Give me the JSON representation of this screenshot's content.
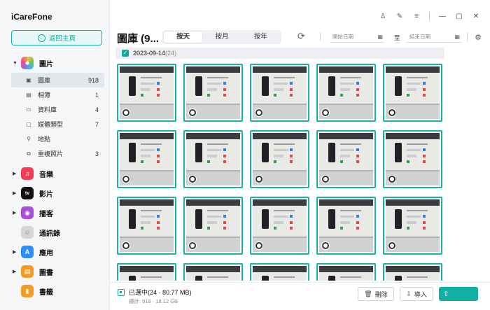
{
  "app": {
    "title": "iCareFone"
  },
  "sidebar": {
    "home_label": "返回主頁",
    "categories": [
      {
        "label": "圖片",
        "color": "#f5a33b",
        "glyph": "✿"
      },
      {
        "label": "音樂",
        "color": "#f23b55",
        "glyph": "♫"
      },
      {
        "label": "影片",
        "color": "#111111",
        "glyph": "tv"
      },
      {
        "label": "播客",
        "color": "#a84fd8",
        "glyph": "◉"
      },
      {
        "label": "通訊錄",
        "color": "#c8c8c8",
        "glyph": "☺"
      },
      {
        "label": "應用",
        "color": "#2f8ef5",
        "glyph": "A"
      },
      {
        "label": "圖書",
        "color": "#f59a22",
        "glyph": "▤"
      },
      {
        "label": "書籤",
        "color": "#f59a22",
        "glyph": "▮"
      }
    ],
    "photo_items": [
      {
        "label": "圖庫",
        "count": "918",
        "icon": "image-icon"
      },
      {
        "label": "相簿",
        "count": "1",
        "icon": "album-icon"
      },
      {
        "label": "資料庫",
        "count": "4",
        "icon": "folder-icon"
      },
      {
        "label": "媒體類型",
        "count": "7",
        "icon": "media-type-icon"
      },
      {
        "label": "地點",
        "count": "",
        "icon": "location-pin-icon"
      },
      {
        "label": "重複照片",
        "count": "3",
        "icon": "duplicate-icon"
      }
    ]
  },
  "toolbar": {
    "title": "圖庫 (9...",
    "tabs": [
      "按天",
      "按月",
      "按年"
    ],
    "active_tab": 0,
    "start_date_placeholder": "開始日期",
    "to_label": "至",
    "end_date_placeholder": "結束日期"
  },
  "group": {
    "date": "2023-09-14",
    "count": "(24)"
  },
  "footer": {
    "selected": "已選中(24 · 80.77 MB)",
    "total": "總計: 918 · 18.12 GB",
    "delete_label": "刪除",
    "import_label": "導入",
    "export_label": "匯出"
  },
  "colors": {
    "accent": "#12a69a",
    "thumb_border": "#19b2a6"
  }
}
